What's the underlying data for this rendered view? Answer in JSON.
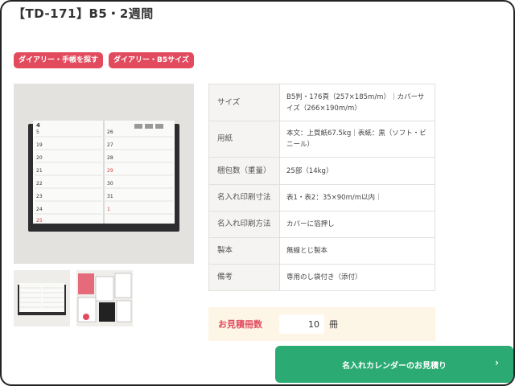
{
  "product": {
    "title": "【TD-171】B5・2週間"
  },
  "tags": [
    {
      "label": "ダイアリー・手帳を探す"
    },
    {
      "label": "ダイアリー・B5サイズ"
    }
  ],
  "preview": {
    "month": "4",
    "days_left": [
      "5",
      "19",
      "20",
      "21",
      "22",
      "23",
      "24",
      "25"
    ],
    "days_right": [
      "26",
      "27",
      "28",
      "29",
      "30",
      "31",
      "1"
    ]
  },
  "specs": [
    {
      "key": "サイズ",
      "value": "B5判・176頁（257×185m/m）｜カバーサイズ（266×190m/m）"
    },
    {
      "key": "用紙",
      "value": "本文：上質紙67.5kg｜表紙：黒（ソフト・ビニール）"
    },
    {
      "key": "梱包数（重量）",
      "value": "25部（14kg）"
    },
    {
      "key": "名入れ印刷寸法",
      "value": "表1・表2：35×90m/m以内｜"
    },
    {
      "key": "名入れ印刷方法",
      "value": "カバーに箔押し"
    },
    {
      "key": "製本",
      "value": "無線とじ製本"
    },
    {
      "key": "備考",
      "value": "専用のし袋付き（添付）"
    }
  ],
  "quote": {
    "label": "お見積冊数",
    "quantity": "10",
    "unit": "冊"
  },
  "cta": {
    "label": "名入れカレンダーのお見積り",
    "chevron": "›"
  },
  "colors": {
    "tag": "#e24a5e",
    "cta": "#2bab73",
    "quote_bg": "#fdf5e6"
  }
}
